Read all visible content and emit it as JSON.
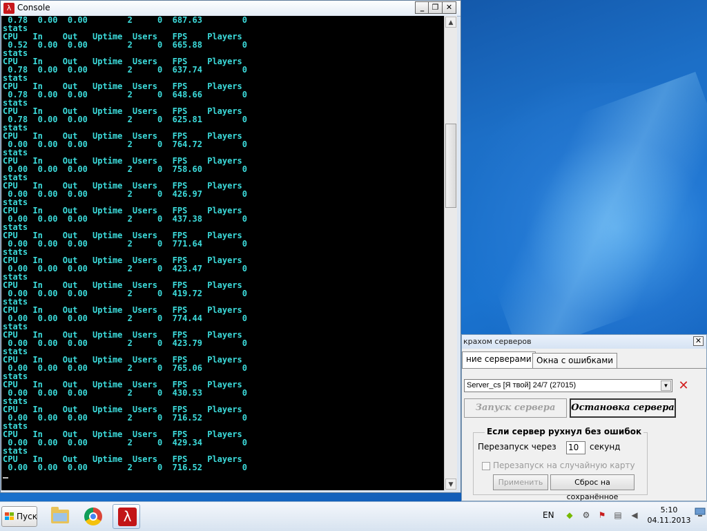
{
  "console": {
    "title": "Console",
    "lines": [
      " 0.78  0.00  0.00        2     0  687.63        0",
      "stats",
      "CPU   In    Out   Uptime  Users   FPS    Players",
      " 0.52  0.00  0.00        2     0  665.88        0",
      "stats",
      "CPU   In    Out   Uptime  Users   FPS    Players",
      " 0.78  0.00  0.00        2     0  637.74        0",
      "stats",
      "CPU   In    Out   Uptime  Users   FPS    Players",
      " 0.78  0.00  0.00        2     0  648.66        0",
      "stats",
      "CPU   In    Out   Uptime  Users   FPS    Players",
      " 0.78  0.00  0.00        2     0  625.81        0",
      "stats",
      "CPU   In    Out   Uptime  Users   FPS    Players",
      " 0.00  0.00  0.00        2     0  764.72        0",
      "stats",
      "CPU   In    Out   Uptime  Users   FPS    Players",
      " 0.00  0.00  0.00        2     0  758.60        0",
      "stats",
      "CPU   In    Out   Uptime  Users   FPS    Players",
      " 0.00  0.00  0.00        2     0  426.97        0",
      "stats",
      "CPU   In    Out   Uptime  Users   FPS    Players",
      " 0.00  0.00  0.00        2     0  437.38        0",
      "stats",
      "CPU   In    Out   Uptime  Users   FPS    Players",
      " 0.00  0.00  0.00        2     0  771.64        0",
      "stats",
      "CPU   In    Out   Uptime  Users   FPS    Players",
      " 0.00  0.00  0.00        2     0  423.47        0",
      "stats",
      "CPU   In    Out   Uptime  Users   FPS    Players",
      " 0.00  0.00  0.00        2     0  419.72        0",
      "stats",
      "CPU   In    Out   Uptime  Users   FPS    Players",
      " 0.00  0.00  0.00        2     0  774.44        0",
      "stats",
      "CPU   In    Out   Uptime  Users   FPS    Players",
      " 0.00  0.00  0.00        2     0  423.79        0",
      "stats",
      "CPU   In    Out   Uptime  Users   FPS    Players",
      " 0.00  0.00  0.00        2     0  765.06        0",
      "stats",
      "CPU   In    Out   Uptime  Users   FPS    Players",
      " 0.00  0.00  0.00        2     0  430.53        0",
      "stats",
      "CPU   In    Out   Uptime  Users   FPS    Players",
      " 0.00  0.00  0.00        2     0  716.52        0",
      "stats",
      "CPU   In    Out   Uptime  Users   FPS    Players",
      " 0.00  0.00  0.00        2     0  429.34        0",
      "stats",
      "CPU   In    Out   Uptime  Users   FPS    Players",
      " 0.00  0.00  0.00        2     0  716.52        0"
    ],
    "colors": {
      "text": "#3cdcdc",
      "background": "#000000"
    }
  },
  "manager": {
    "title": "крахом серверов",
    "tabs": [
      {
        "label": "ние серверами"
      },
      {
        "label": "Окна с ошибками"
      }
    ],
    "server_select": "Server_cs [Я твой] 24/7 (27015)",
    "start_button": "Запуск сервера",
    "stop_button": "Остановка сервера",
    "group_title": "Если сервер рухнул без ошибок",
    "restart_label": "Перезапуск через",
    "restart_value": "10",
    "restart_unit": "секунд",
    "random_map_label": "Перезапуск на случайную карту",
    "apply_button": "Применить",
    "reset_button": "Сброс на сохранённое"
  },
  "taskbar": {
    "start_label": "Пуск",
    "language": "EN",
    "time": "5:10",
    "date": "04.11.2013"
  }
}
